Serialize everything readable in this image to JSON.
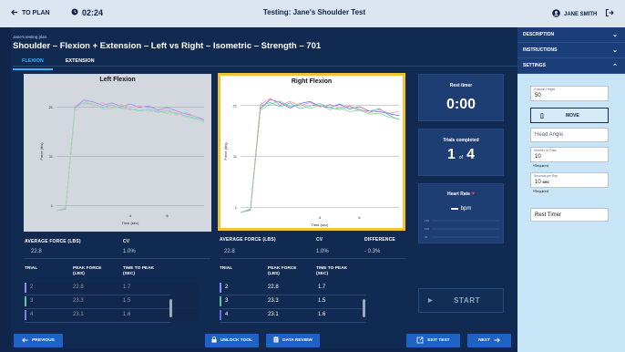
{
  "header": {
    "back_label": "TO PLAN",
    "timer": "02:24",
    "title": "Testing: Jane's Shoulder Test",
    "user_name": "JANE SMITH"
  },
  "plan": {
    "label": "Jane's testing plan",
    "title": "Shoulder – Flexion + Extension – Left vs Right – Isometric – Strength – 701"
  },
  "tabs": [
    {
      "label": "FLEXION",
      "active": true
    },
    {
      "label": "EXTENSION",
      "active": false
    }
  ],
  "chart_data": [
    {
      "type": "line",
      "title": "Left Flexion",
      "xlabel": "Time (sec)",
      "ylabel": "Force (lbs)",
      "x_ticks": [
        4,
        6
      ],
      "y_ticks": [
        1,
        11,
        21
      ],
      "xlim": [
        0,
        8
      ],
      "ylim": [
        0,
        24
      ],
      "series": [
        {
          "values": [
            0,
            0.3,
            21,
            22.4,
            22,
            21.3,
            21.8,
            21.1,
            21.6,
            20.9,
            21.2,
            20.4,
            20.9,
            20.2,
            19.6,
            19.1,
            18.3
          ],
          "color": "#8f8fff"
        },
        {
          "values": [
            0,
            0.4,
            21,
            21.8,
            21.6,
            20.9,
            21.4,
            20.7,
            20.6,
            20.2,
            20.5,
            19.9,
            20.2,
            19.6,
            19.2,
            18.8,
            17.9
          ],
          "color": "#6fd2ce"
        },
        {
          "values": [
            0,
            0.6,
            20.6,
            22.3,
            21.2,
            21.9,
            20.9,
            21.5,
            20.9,
            21.2,
            20.8,
            20.1,
            20.6,
            19.4,
            19.9,
            19.1,
            18.6
          ],
          "color": "#f2a6c4"
        },
        {
          "values": [
            0,
            0.5,
            20.2,
            21.4,
            21.7,
            20.6,
            20.6,
            21.3,
            20.4,
            20.7,
            20.1,
            20.3,
            19.7,
            19.8,
            18.9,
            18.6,
            18
          ],
          "color": "#a8d8a8"
        }
      ]
    },
    {
      "type": "line",
      "title": "Right Flexion",
      "xlabel": "Time (sec)",
      "ylabel": "Force (lbs)",
      "x_ticks": [
        4,
        6
      ],
      "y_ticks": [
        1,
        11,
        21
      ],
      "xlim": [
        0,
        8
      ],
      "ylim": [
        0,
        24
      ],
      "series": [
        {
          "values": [
            0,
            0.5,
            20.4,
            22.2,
            21.6,
            20.5,
            21.4,
            21.8,
            20.9,
            20.6,
            21.3,
            20.3,
            20.8,
            19.9,
            19.8,
            19.4,
            19
          ],
          "color": "#6c6cf0"
        },
        {
          "values": [
            0,
            0.7,
            20.9,
            21.6,
            20.8,
            21.5,
            20.4,
            20.9,
            21.4,
            20.6,
            20.2,
            20.8,
            20.1,
            19.9,
            20.4,
            19.1,
            18.2
          ],
          "color": "#4fc7c2"
        },
        {
          "values": [
            0,
            0.4,
            21.2,
            22.4,
            21.1,
            21.8,
            20.9,
            21.6,
            20.7,
            21.2,
            20.6,
            20.9,
            20.3,
            19.6,
            20.2,
            19.5,
            19.8
          ],
          "color": "#f08fb8"
        },
        {
          "values": [
            0,
            0.6,
            20.1,
            21.3,
            21.9,
            20.8,
            21.3,
            20.4,
            21.1,
            20.2,
            20.6,
            19.8,
            20.1,
            19.3,
            19.5,
            18.7,
            18.4
          ],
          "color": "#8fd08f"
        }
      ]
    }
  ],
  "side": {
    "rest_timer_label": "Rest timer",
    "rest_timer_value": "0:00",
    "trials_label": "Trials completed",
    "trials_done": "1",
    "trials_of": "of",
    "trials_total": "4",
    "heart_rate_label": "Heart Rate",
    "heart_rate_unit": "bpm",
    "heart_rate_y_ticks": [
      "160",
      "100",
      "40"
    ],
    "start_label": "START"
  },
  "left_stats": {
    "avg_label": "AVERAGE FORCE (LBS)",
    "avg_value": "22.8",
    "cv_label": "CV",
    "cv_value": "1.0%"
  },
  "right_stats": {
    "avg_label": "AVERAGE FORCE (LBS)",
    "avg_value": "22.8",
    "cv_label": "CV",
    "cv_value": "1.0%",
    "diff_label": "DIFFERENCE",
    "diff_value": "- 0.3%"
  },
  "trial_table": {
    "headers": [
      "TRIAL",
      "PEAK FORCE (LBS)",
      "TIME TO PEAK (SEC)"
    ]
  },
  "left_trials": [
    {
      "trial": "2",
      "peak": "22.8",
      "time": "1.7",
      "color": "#8f8fff"
    },
    {
      "trial": "3",
      "peak": "23.3",
      "time": "1.5",
      "color": "#5fc89a"
    },
    {
      "trial": "4",
      "peak": "23.1",
      "time": "1.6",
      "color": "#7f7fe8"
    }
  ],
  "right_trials": [
    {
      "trial": "2",
      "peak": "22.8",
      "time": "1.7",
      "color": "#8f8fff"
    },
    {
      "trial": "3",
      "peak": "23.3",
      "time": "1.5",
      "color": "#5fc89a"
    },
    {
      "trial": "4",
      "peak": "23.1",
      "time": "1.6",
      "color": "#6c6cf0"
    }
  ],
  "footer": {
    "previous_label": "PREVIOUS",
    "unlock_label": "UNLOCK TOOL",
    "review_label": "DATA REVIEW",
    "exit_label": "EXIT TEST",
    "next_label": "NEXT"
  },
  "settings_panel": {
    "description_label": "DESCRIPTION",
    "instructions_label": "INSTRUCTIONS",
    "settings_label": "SETTINGS",
    "cushion_label": "Cushion Height",
    "cushion_value": "50",
    "move_label": "MOVE",
    "head_angle_placeholder": "Head Angle",
    "trials_label": "Number of Trials",
    "trials_value": "10",
    "required_text": "*Required",
    "seconds_label": "Seconds per Rep",
    "seconds_value": "10",
    "seconds_unit": "sec",
    "rest_timer_placeholder": "Rest Timer"
  },
  "colors": {
    "background": "#0f2549",
    "accent_blue": "#1e63c4",
    "highlight_yellow": "#f2c230",
    "heart": "#e8414f"
  }
}
